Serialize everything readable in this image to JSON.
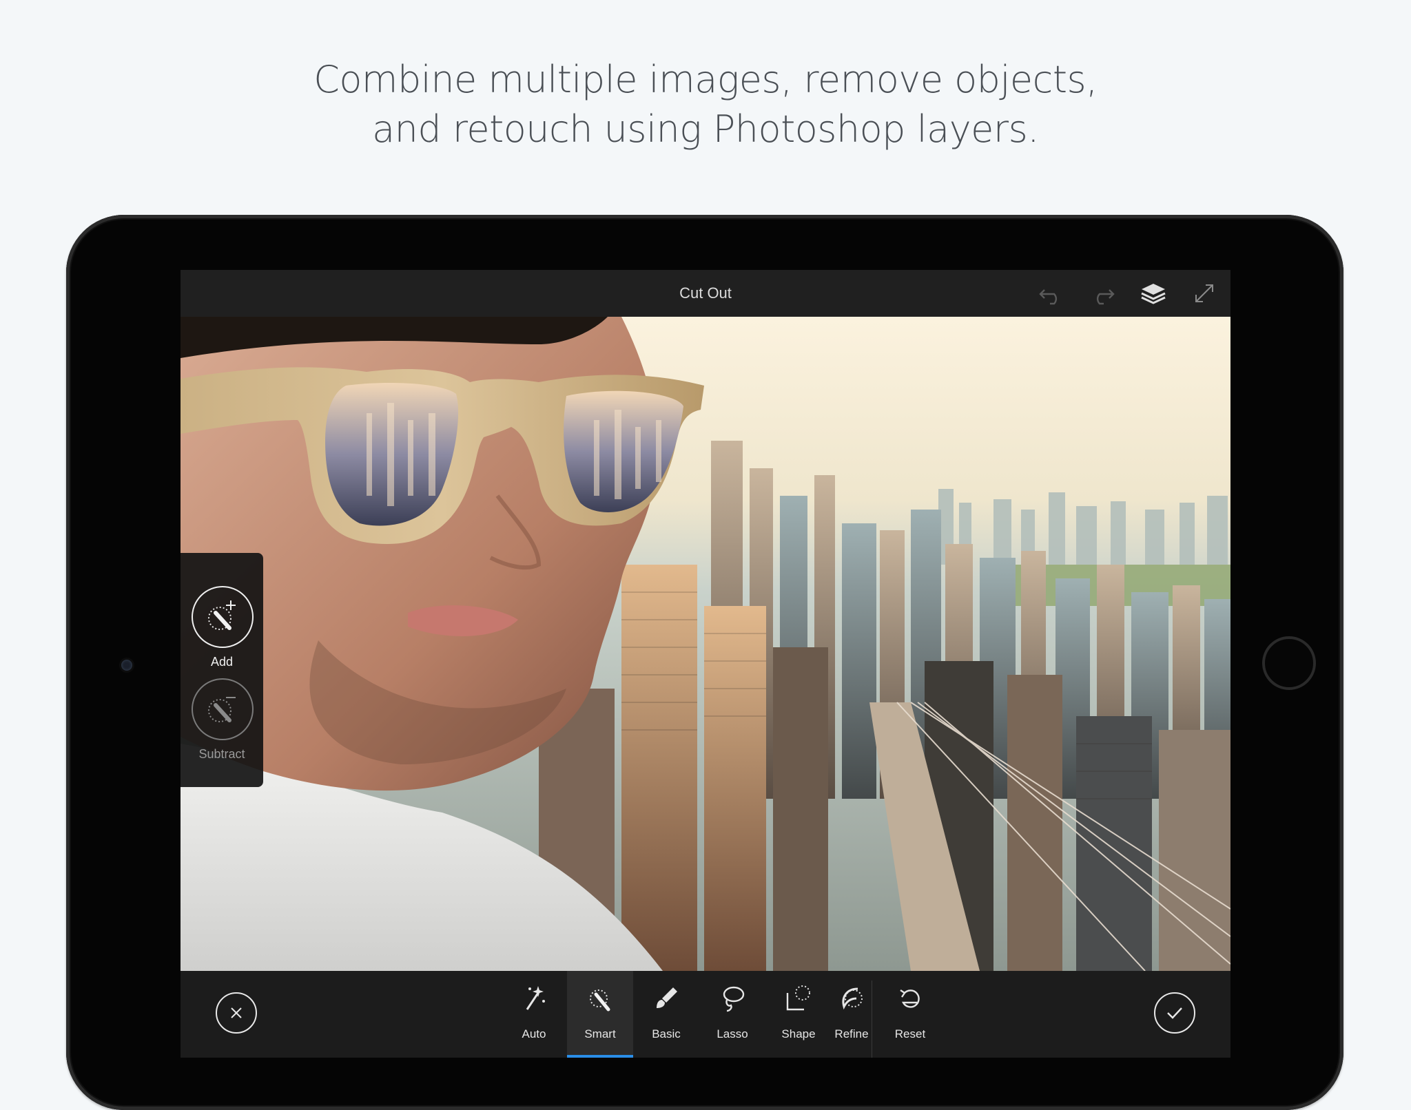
{
  "headline": {
    "line1": "Combine multiple images, remove objects,",
    "line2": "and retouch using Photoshop layers."
  },
  "app": {
    "title": "Cut Out",
    "icons": {
      "undo": "undo-icon",
      "redo": "redo-icon",
      "layers": "layers-icon",
      "fullscreen": "expand-icon"
    }
  },
  "side_tools": {
    "add_label": "Add",
    "subtract_label": "Subtract"
  },
  "bottom_toolbar": {
    "tabs": [
      {
        "label": "Auto",
        "icon": "magic-wand-icon"
      },
      {
        "label": "Smart",
        "icon": "smart-select-icon",
        "active": true
      },
      {
        "label": "Basic",
        "icon": "brush-icon"
      },
      {
        "label": "Lasso",
        "icon": "lasso-icon"
      },
      {
        "label": "Shape",
        "icon": "shape-select-icon"
      },
      {
        "label": "Refine",
        "icon": "refine-icon"
      }
    ],
    "reset_label": "Reset",
    "cancel_icon": "close-icon",
    "confirm_icon": "checkmark-icon"
  },
  "colors": {
    "accent": "#2a8ee8",
    "toolbar_bg": "#1c1c1c",
    "page_bg": "#f4f7f9"
  }
}
